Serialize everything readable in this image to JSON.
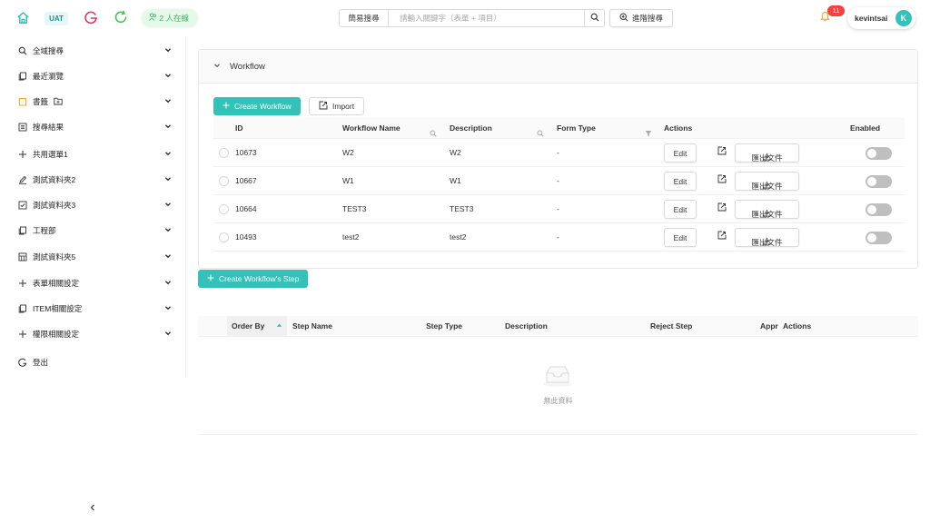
{
  "header": {
    "env_badge": "UAT",
    "online": "2 人在線",
    "search": {
      "mode": "簡易搜尋",
      "placeholder": "請輸入關鍵字（表單 + 項目）"
    },
    "advanced_search": "進階搜尋",
    "notifications": "11",
    "user": {
      "name": "kevintsai",
      "initial": "K"
    }
  },
  "sidebar": {
    "items": [
      {
        "label": "全域搜尋",
        "icon": "search-icon"
      },
      {
        "label": "最近瀏覽",
        "icon": "copy-icon"
      },
      {
        "label": "書籤",
        "icon": "bookmark-icon"
      },
      {
        "label": "搜尋結果",
        "icon": "list-icon"
      },
      {
        "label": "共用選單1",
        "icon": "plus-icon"
      },
      {
        "label": "測試資料夾2",
        "icon": "edit-icon"
      },
      {
        "label": "測試資料夾3",
        "icon": "checkbox-icon"
      },
      {
        "label": "工程部",
        "icon": "copy-icon"
      },
      {
        "label": "測試資料夾5",
        "icon": "table-icon"
      },
      {
        "label": "表單相關設定",
        "icon": "plus-icon"
      },
      {
        "label": "ITEM相關設定",
        "icon": "copy-icon"
      },
      {
        "label": "權限相關設定",
        "icon": "plus-icon"
      }
    ],
    "logout": "登出"
  },
  "workflow": {
    "panel_title": "Workflow",
    "create_button": "Create Workflow",
    "import_button": "Import",
    "columns": [
      "ID",
      "Workflow Name",
      "Description",
      "Form Type",
      "Actions",
      "Enabled"
    ],
    "rows": [
      {
        "id": "10673",
        "name": "W2",
        "description": "W2",
        "form_type": "-"
      },
      {
        "id": "10667",
        "name": "W1",
        "description": "W1",
        "form_type": "-"
      },
      {
        "id": "10664",
        "name": "TEST3",
        "description": "TEST3",
        "form_type": "-"
      },
      {
        "id": "10493",
        "name": "test2",
        "description": "test2",
        "form_type": "-"
      }
    ],
    "edit_label": "Edit",
    "export_label": "匯出文件"
  },
  "steps": {
    "create_button": "Create Workflow's Step",
    "columns": [
      "Order By",
      "Step Name",
      "Step Type",
      "Description",
      "Reject Step",
      "Appr",
      "Actions"
    ],
    "empty_text": "無此資料"
  },
  "colors": {
    "accent": "#33c1b8",
    "badge": "#f5403b"
  }
}
